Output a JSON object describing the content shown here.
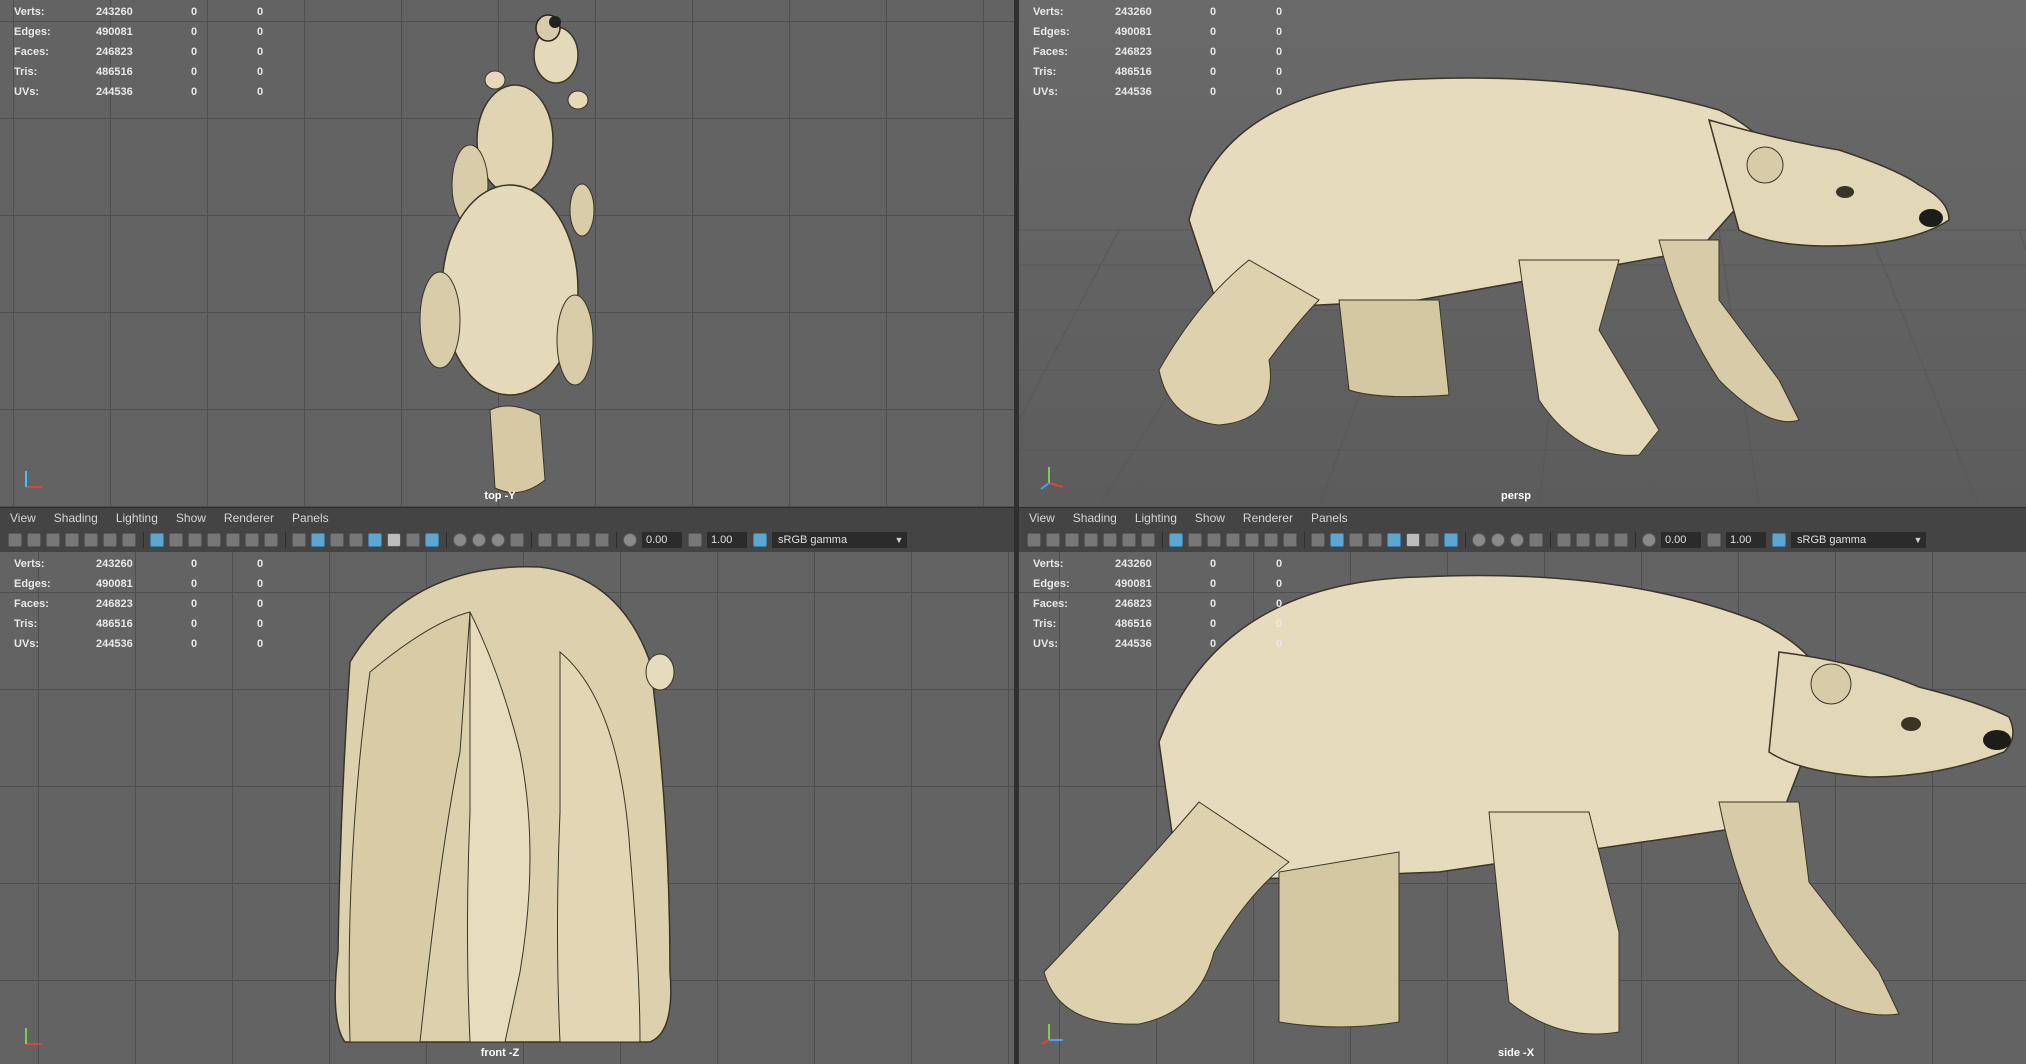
{
  "stats": [
    {
      "label": "Verts:",
      "v1": "243260",
      "v2": "0",
      "v3": "0"
    },
    {
      "label": "Edges:",
      "v1": "490081",
      "v2": "0",
      "v3": "0"
    },
    {
      "label": "Faces:",
      "v1": "246823",
      "v2": "0",
      "v3": "0"
    },
    {
      "label": "Tris:",
      "v1": "486516",
      "v2": "0",
      "v3": "0"
    },
    {
      "label": "UVs:",
      "v1": "244536",
      "v2": "0",
      "v3": "0"
    }
  ],
  "viewports": {
    "top": {
      "label": "top -Y"
    },
    "persp": {
      "label": "persp"
    },
    "front": {
      "label": "front -Z"
    },
    "side": {
      "label": "side -X"
    }
  },
  "menu": {
    "view": "View",
    "shading": "Shading",
    "lighting": "Lighting",
    "show": "Show",
    "renderer": "Renderer",
    "panels": "Panels"
  },
  "toolbar": {
    "exposure": "0.00",
    "gamma_value": "1.00",
    "color_space": "sRGB gamma"
  },
  "colors": {
    "viewport_bg": "#636363",
    "grid": "#4f4f4f",
    "bear": "#e6dcbd",
    "accent": "#5ea6cf"
  }
}
